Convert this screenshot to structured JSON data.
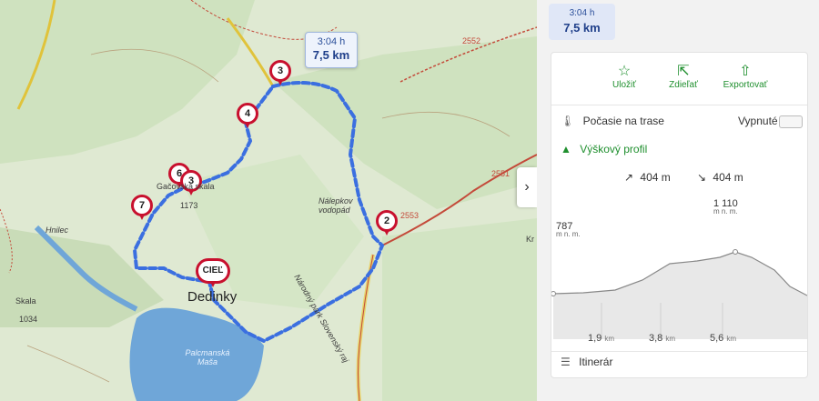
{
  "map": {
    "route_bubble": {
      "time": "3:04 h",
      "distance": "7,5 km"
    },
    "markers": [
      "2",
      "3",
      "4",
      "6",
      "7",
      "3"
    ],
    "goal_label": "CIEĽ",
    "labels": {
      "village": "Dedinky",
      "lake": "Palcmanská Maša",
      "skala": "Skala",
      "skala_elev": "1034",
      "nalepkov": "Nálepkov vodopád",
      "gacovska": "Gačovská skala",
      "point_1173": "1173",
      "hnilec": "Hnilec",
      "road_2551": "2551",
      "road_2552": "2552",
      "road_2553": "2553",
      "park": "Národný park Slovenský raj",
      "kr": "Kr"
    },
    "colors": {
      "route": "#3b6fe0",
      "marker": "#c8102e",
      "water": "#6fa6d8",
      "forest": "#cfe2bf"
    }
  },
  "panel": {
    "collapse_icon": "›",
    "summary": {
      "time": "3:04 h",
      "distance": "7,5 km"
    },
    "actions": [
      {
        "icon": "star-icon",
        "glyph": "☆",
        "label": "Uložiť"
      },
      {
        "icon": "share-icon",
        "glyph": "⇱",
        "label": "Zdieľať"
      },
      {
        "icon": "export-icon",
        "glyph": "⇧",
        "label": "Exportovať"
      }
    ],
    "weather_label": "Počasie na trase",
    "weather_toggle_label": "Vypnuté",
    "elevation_title": "Výškový profil",
    "ascent": "404 m",
    "descent": "404 m",
    "start_elev": "787",
    "max_elev": "1 110",
    "unit": "m n. m.",
    "km_ticks": [
      {
        "value": "1,9",
        "unit": "km"
      },
      {
        "value": "3,8",
        "unit": "km"
      },
      {
        "value": "5,6",
        "unit": "km"
      }
    ],
    "itinerary_label": "Itinerár",
    "colors": {
      "accent": "#1f8f2e",
      "summary_bg": "#e0e7f7"
    }
  }
}
